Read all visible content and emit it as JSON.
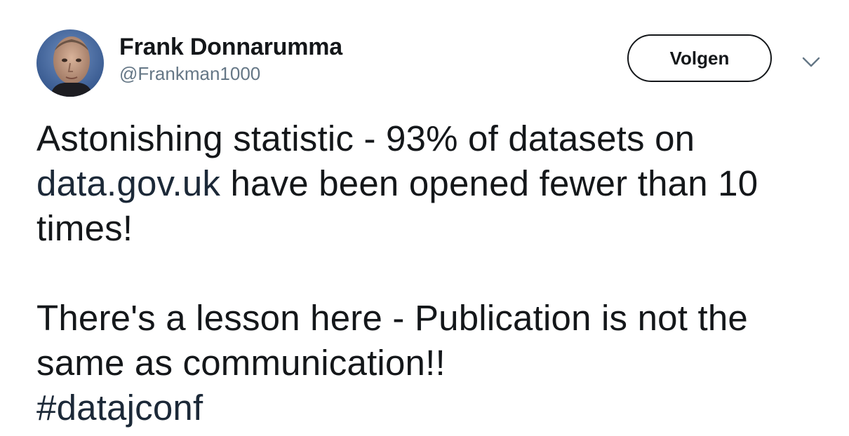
{
  "tweet": {
    "author": {
      "display_name": "Frank Donnarumma",
      "handle": "@Frankman1000"
    },
    "follow_label": "Volgen",
    "text": {
      "line1": "Astonishing statistic - 93% of datasets on",
      "link": "data.gov.uk",
      "line2_rest": " have been opened fewer than 10",
      "line3": "times!",
      "line4": "There's a lesson here - Publication is not the",
      "line5": "same as communication!!",
      "hashtag": "#datajconf"
    },
    "icons": {
      "avatar": "profile-photo",
      "caret": "chevron-down-icon"
    }
  }
}
